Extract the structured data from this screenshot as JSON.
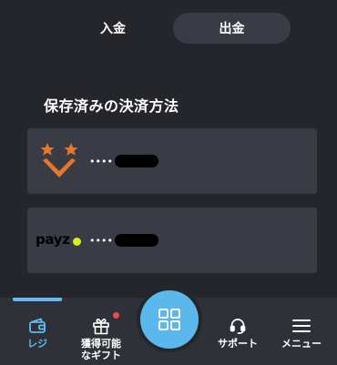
{
  "tabs": {
    "deposit_label": "入金",
    "withdraw_label": "出金",
    "active": "withdraw"
  },
  "saved_methods": {
    "title": "保存済みの決済方法",
    "items": [
      {
        "logo": "sticpay-logo",
        "masked": "••••"
      },
      {
        "logo": "payz-logo",
        "logo_text": "payz",
        "masked": "••••"
      }
    ]
  },
  "bottom_nav": {
    "items": [
      {
        "label": "レジ",
        "icon": "wallet-icon",
        "active": true
      },
      {
        "label": "獲得可能なギフト",
        "label_line1": "獲得可能",
        "label_line2": "なギフト",
        "icon": "gift-icon",
        "badge": true
      },
      {
        "label": "",
        "icon": "grid-icon"
      },
      {
        "label": "サポート",
        "icon": "headset-icon"
      },
      {
        "label": "メニュー",
        "icon": "hamburger-menu-icon"
      }
    ]
  },
  "colors": {
    "background": "#24262c",
    "card": "#393c45",
    "accent": "#5fbcec",
    "fab": "#5ab8ec",
    "badge": "#ee4b50",
    "sticpay_orange": "#e8772c",
    "payz_dot": "#d6f01f"
  }
}
